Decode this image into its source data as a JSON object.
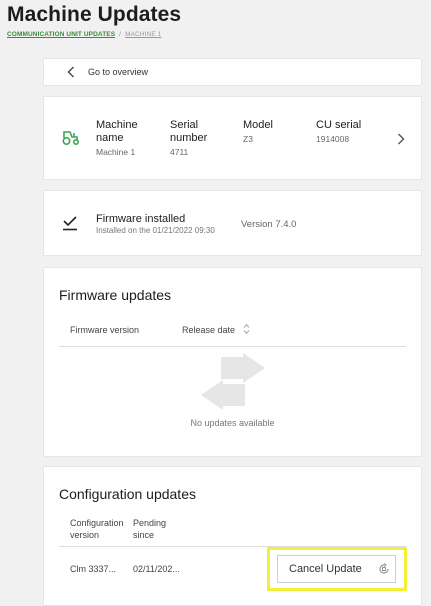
{
  "header": {
    "title": "Machine Updates",
    "breadcrumb": [
      "COMMUNICATION UNIT UPDATES",
      "MACHINE 1"
    ]
  },
  "back": {
    "label": "Go to overview"
  },
  "machine": {
    "columns": [
      {
        "label": "Machine\nname",
        "value": "Machine 1"
      },
      {
        "label": "Serial\nnumber",
        "value": "4711"
      },
      {
        "label": "Model",
        "value": "Z3"
      },
      {
        "label": "CU serial",
        "value": "1914008"
      }
    ],
    "icon": "tractor-icon",
    "accent_color": "#3aa655"
  },
  "firmware_installed": {
    "title": "Firmware installed",
    "subtitle": "Installed on the 01/21/2022 09:30",
    "version": "Version 7.4.0"
  },
  "firmware_updates": {
    "title": "Firmware updates",
    "columns": [
      "Firmware version",
      "Release date"
    ],
    "empty_text": "No updates available"
  },
  "config_updates": {
    "title": "Configuration updates",
    "columns": [
      "Configuration\nversion",
      "Pending\nsince"
    ],
    "rows": [
      {
        "version": "Clm 3337...",
        "pending": "02/11/202...",
        "action": "Cancel Update"
      }
    ],
    "highlight_color": "#f2ee3a"
  }
}
